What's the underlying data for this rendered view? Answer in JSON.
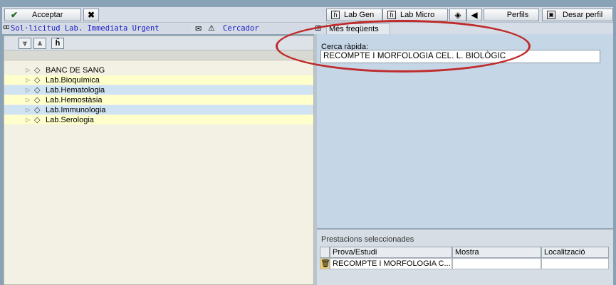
{
  "toolbar": {
    "accept_label": "Acceptar",
    "lab_gen_label": "Lab Gen",
    "lab_micro_label": "Lab Micro",
    "perfils_label": "Perfils",
    "desar_perfil_label": "Desar perfil"
  },
  "header": {
    "request_type": "Sol·licitud Lab. Immediata Urgent",
    "search_field": "Cercador",
    "tab_frequent": "Més freqüents"
  },
  "tree": {
    "items": [
      {
        "label": "BANC DE SANG"
      },
      {
        "label": "Lab.Bioquímica"
      },
      {
        "label": "Lab.Hematologia"
      },
      {
        "label": "Lab.Hemostàsia"
      },
      {
        "label": "Lab.Immunologia"
      },
      {
        "label": "Lab.Serologia"
      }
    ]
  },
  "quick_search": {
    "label": "Cerca ràpida:",
    "value": "RECOMPTE I MORFOLOGIA CEL. L. BIOLÒGIC"
  },
  "selected": {
    "title": "Prestacions seleccionades",
    "columns": [
      "Prova/Estudi",
      "Mostra",
      "Localització"
    ],
    "rows": [
      {
        "prova": "RECOMPTE I MORFOLOGIA C...",
        "mostra": "",
        "localitzacio": ""
      }
    ]
  },
  "colors": {
    "accent_oval": "#c02a2a",
    "tree_highlight_yellow": "#ffffcc",
    "tree_highlight_blue": "#cfe3f2",
    "field_text": "#1a1acc"
  },
  "icons": [
    "check-icon",
    "close-icon",
    "binoculars-icon",
    "envelope-icon",
    "triangle-warning-icon",
    "multiple-selection-icon",
    "folder-icon",
    "expand-arrow-icon",
    "trash-icon",
    "collapse-all-icon",
    "expand-all-icon",
    "eraser-icon",
    "back-icon"
  ]
}
